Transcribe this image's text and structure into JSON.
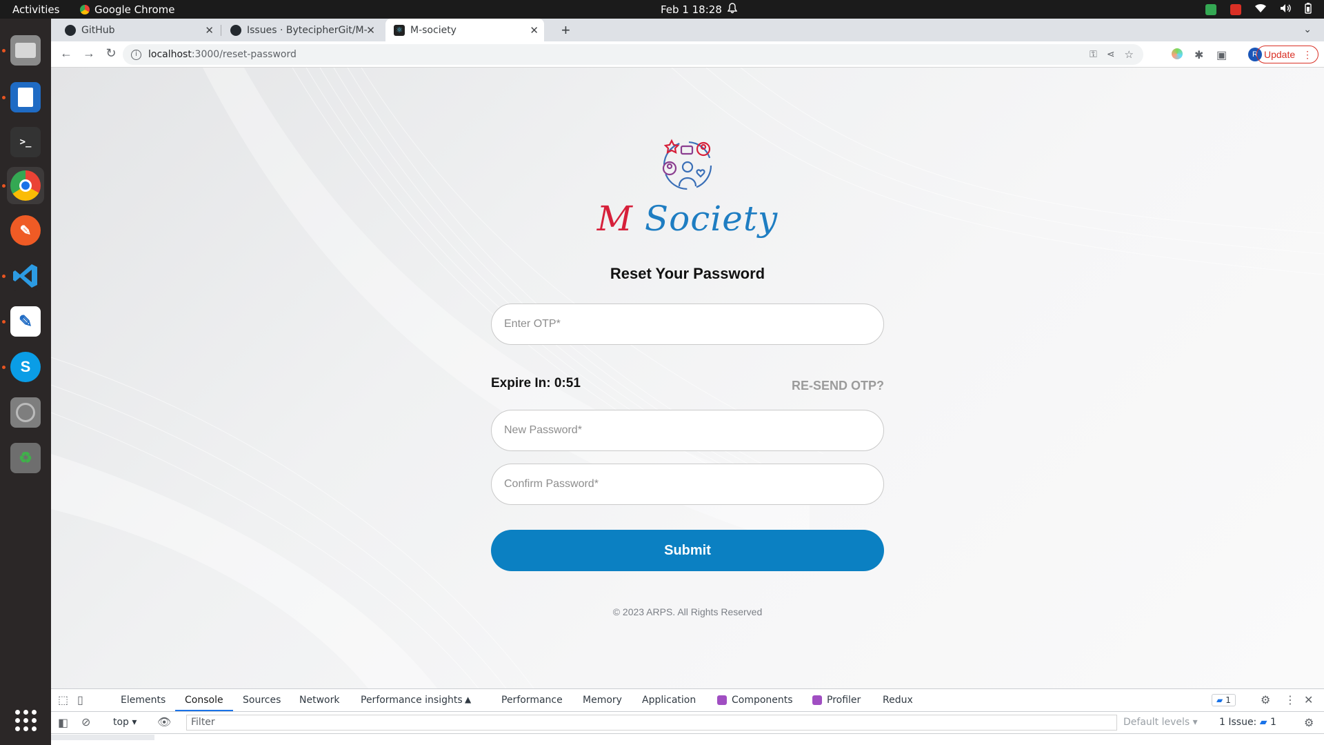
{
  "topbar": {
    "activities": "Activities",
    "app_name": "Google Chrome",
    "clock": "Feb 1  18:28"
  },
  "browser": {
    "tabs": [
      {
        "title": "GitHub",
        "icon": "github-icon"
      },
      {
        "title": "Issues · BytecipherGit/M-S",
        "icon": "github-icon"
      },
      {
        "title": "M-society",
        "icon": "react-icon"
      }
    ],
    "url_host": "localhost",
    "url_path": ":3000/reset-password",
    "profile_initial": "R",
    "update_label": "Update"
  },
  "page": {
    "brand_m": "M",
    "brand_society": "Society",
    "heading": "Reset Your Password",
    "otp_placeholder": "Enter OTP*",
    "expire_text": "Expire In: 0:51",
    "resend_label": "RE-SEND OTP?",
    "new_password_placeholder": "New Password*",
    "confirm_password_placeholder": "Confirm Password*",
    "submit_label": "Submit",
    "footer": "© 2023 ARPS. All Rights Reserved",
    "colors": {
      "brand_red": "#d6203a",
      "brand_blue": "#1e7dc2",
      "button_blue": "#0b80c2"
    }
  },
  "devtools": {
    "tabs": [
      "Elements",
      "Console",
      "Sources",
      "Network",
      "Performance insights",
      "Performance",
      "Memory",
      "Application",
      "Components",
      "Profiler",
      "Redux"
    ],
    "active_tab": "Console",
    "messages_count": "1",
    "context": "top",
    "filter_placeholder": "Filter",
    "levels": "Default levels",
    "issues_label": "1 Issue:",
    "issues_count": "1"
  }
}
